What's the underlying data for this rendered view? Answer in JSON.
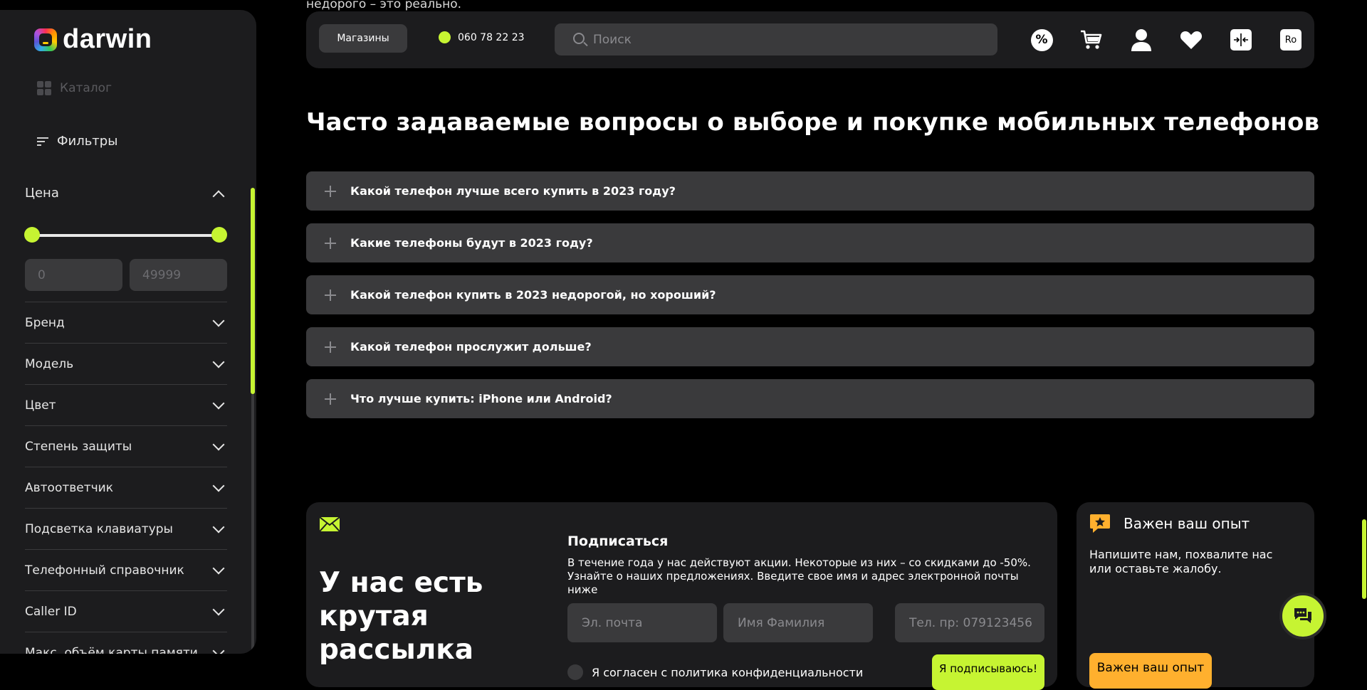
{
  "top_fragment": "недорого – это реально.",
  "sidebar": {
    "logo_text": "darwin",
    "catalog_label": "Каталог",
    "filters_label": "Фильтры",
    "price": {
      "label": "Цена",
      "min_placeholder": "0",
      "max_placeholder": "49999"
    },
    "filter_groups": [
      {
        "label": "Бренд"
      },
      {
        "label": "Модель"
      },
      {
        "label": "Цвет"
      },
      {
        "label": "Степень защиты"
      },
      {
        "label": "Автоответчик"
      },
      {
        "label": "Подсветка клавиатуры"
      },
      {
        "label": "Телефонный справочник"
      },
      {
        "label": "Caller ID"
      },
      {
        "label": "Макс. объём карты памяти"
      }
    ]
  },
  "header": {
    "stores_label": "Магазины",
    "phone": "060 78 22 23",
    "search_placeholder": "Поиск",
    "percent_icon_text": "%",
    "lang_label": "Ro"
  },
  "faq": {
    "title": "Часто задаваемые вопросы о выборе и покупке мобильных телефонов",
    "items": [
      {
        "question": "Какой телефон лучше всего купить в 2023 году?"
      },
      {
        "question": "Какие телефоны будут в 2023 году?"
      },
      {
        "question": "Какой телефон купить в 2023 недорогой, но хороший?"
      },
      {
        "question": "Какой телефон прослужит дольше?"
      },
      {
        "question": "Что лучше купить: iPhone или Android?"
      }
    ]
  },
  "newsletter": {
    "headline": "У нас есть крутая рассылка",
    "title": "Подписаться",
    "text": "В течение года у нас действуют акции. Некоторые из них – со скидками до -50%. Узнайте о наших предложениях. Введите свое имя и адрес электронной почты ниже",
    "email_placeholder": "Эл. почта",
    "name_placeholder": "Имя Фамилия",
    "phone_placeholder": "Тел. пр: 079123456",
    "agree_label": "Я согласен с политика конфиденциальности",
    "subscribe_label": "Я подписываюсь!"
  },
  "feedback": {
    "title": "Важен ваш опыт",
    "text": "Напишите нам, похвалите нас или оставьте жалобу.",
    "button_label": "Важен ваш опыт"
  },
  "colors": {
    "accent": "#c6f432",
    "feedback_accent": "#ffb02e",
    "panel": "#1c1c1e",
    "field": "#3a3a3c"
  }
}
